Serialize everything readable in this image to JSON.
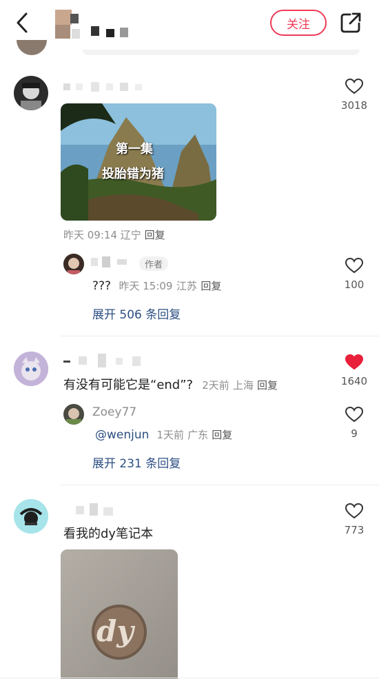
{
  "header": {
    "follow_label": "关注"
  },
  "comments": [
    {
      "likes": "3018",
      "image_title_1": "第一集",
      "image_title_2": "投胎错为猪",
      "meta_time": "昨天 09:14",
      "meta_loc": "辽宁",
      "reply_label": "回复",
      "reply": {
        "badge": "作者",
        "text": "???",
        "meta_time": "昨天 15:09",
        "meta_loc": "江苏",
        "reply_label": "回复",
        "likes": "100"
      },
      "expand": "展开 506 条回复"
    },
    {
      "likes": "1640",
      "liked": true,
      "text": "有没有可能它是“end”?",
      "meta_time": "2天前",
      "meta_loc": "上海",
      "reply_label": "回复",
      "reply": {
        "user": "Zoey77",
        "mention": "@wenjun",
        "meta_time": "1天前",
        "meta_loc": "广东",
        "reply_label": "回复",
        "likes": "9"
      },
      "expand": "展开 231 条回复"
    },
    {
      "likes": "773",
      "text": "看我的dy笔记本",
      "image_logo": "dy"
    }
  ],
  "colors": {
    "accent": "#ee3a56",
    "liked_heart": "#e8203a",
    "link": "#2b4e82"
  }
}
